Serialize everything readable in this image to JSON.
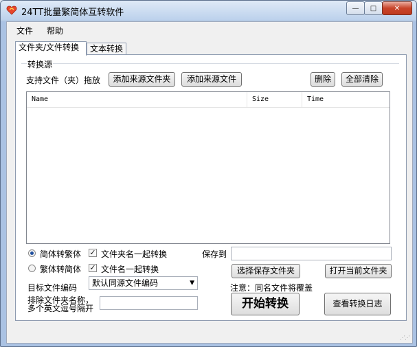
{
  "window": {
    "title": "24TT批量繁简体互转软件",
    "buttons": {
      "minimize": "—",
      "maximize": "□",
      "close": "✕"
    }
  },
  "menu": [
    "文件",
    "帮助"
  ],
  "tabs": [
    {
      "label": "文件夹/文件转换",
      "active": true
    },
    {
      "label": "文本转换",
      "active": false
    }
  ],
  "source_group": {
    "label": "转换源",
    "drag_hint": "支持文件（夹）拖放",
    "add_folder_button": "添加来源文件夹",
    "add_file_button": "添加来源文件",
    "delete_button": "删除",
    "clear_all_button": "全部清除"
  },
  "file_list": {
    "columns": [
      "Name",
      "Size",
      "Time"
    ],
    "rows": []
  },
  "options": {
    "simp_to_trad": {
      "label": "简体转繁体",
      "selected": true
    },
    "trad_to_simp": {
      "label": "繁体转简体",
      "selected": false
    },
    "convert_folder_names": {
      "label": "文件夹名一起转换",
      "checked": true
    },
    "convert_file_names": {
      "label": "文件名一起转换",
      "checked": true
    },
    "target_encoding_label": "目标文件编码",
    "target_encoding_value": "默认同源文件编码",
    "exclude_label_line1": "排除文件夹名称，",
    "exclude_label_line2": "多个英文逗号隔开",
    "exclude_value": ""
  },
  "output": {
    "save_to_label": "保存到",
    "save_path": "",
    "choose_folder_button": "选择保存文件夹",
    "open_folder_button": "打开当前文件夹",
    "overwrite_note": "注意：同名文件将覆盖",
    "start_button": "开始转换",
    "view_log_button": "查看转换日志"
  },
  "icons": {
    "app": "heart-app-icon",
    "dropdown": "chevron-down-icon",
    "resize": "resize-grip-icon"
  }
}
